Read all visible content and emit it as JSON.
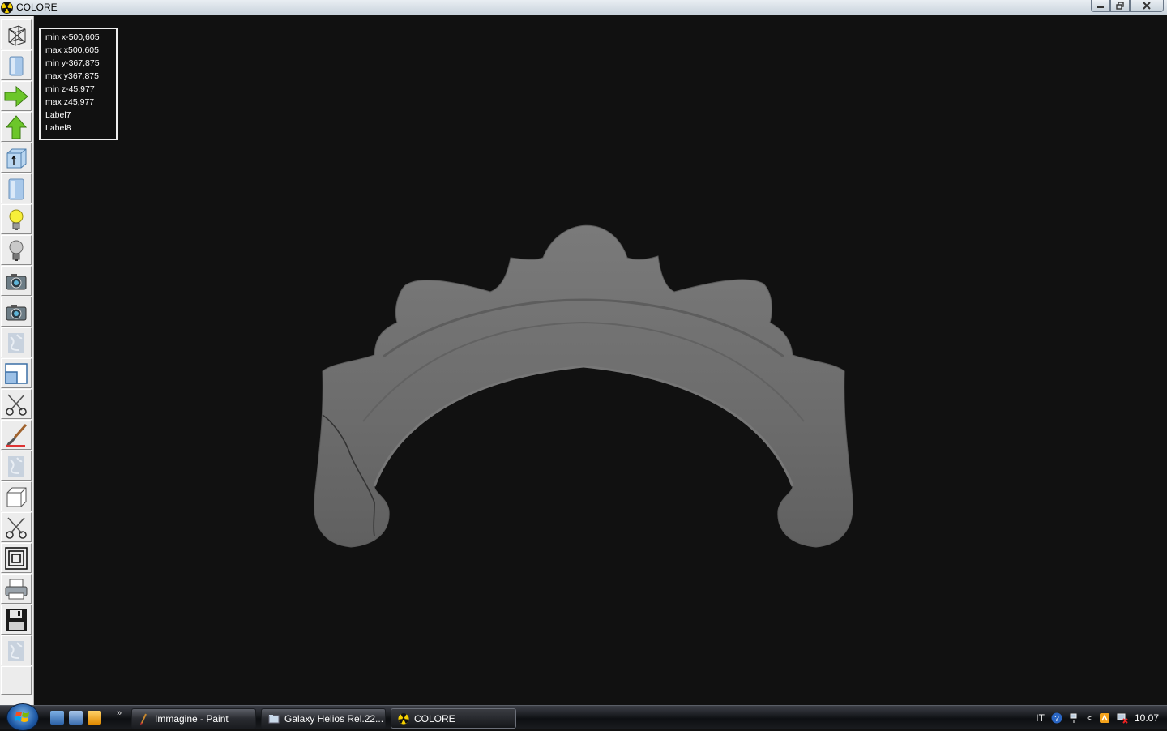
{
  "window": {
    "title": "COLORE",
    "app_icon": "radiation-icon",
    "controls": [
      "minimize-icon",
      "restore-icon",
      "close-icon"
    ]
  },
  "toolbar": {
    "tools": [
      {
        "name": "wireframe-tool",
        "icon": "wireframe-box-icon"
      },
      {
        "name": "solid-view-tool",
        "icon": "blue-cylinder-icon"
      },
      {
        "name": "arrow-right-tool",
        "icon": "green-arrow-right-icon"
      },
      {
        "name": "arrow-up-tool",
        "icon": "green-arrow-up-icon"
      },
      {
        "name": "extrude-tool",
        "icon": "box-arrow-icon"
      },
      {
        "name": "cylinder-tool",
        "icon": "blue-cylinder-icon"
      },
      {
        "name": "light-on-tool",
        "icon": "lightbulb-on-icon"
      },
      {
        "name": "light-off-tool",
        "icon": "lightbulb-off-icon"
      },
      {
        "name": "camera-tool",
        "icon": "camera-icon"
      },
      {
        "name": "camera-2-tool",
        "icon": "camera-icon"
      },
      {
        "name": "texture-tool",
        "icon": "marble-texture-icon"
      },
      {
        "name": "window-split-tool",
        "icon": "window-icon"
      },
      {
        "name": "cut-tool",
        "icon": "scissors-icon"
      },
      {
        "name": "brush-tool",
        "icon": "paintbrush-icon"
      },
      {
        "name": "texture-2-tool",
        "icon": "marble-texture-icon"
      },
      {
        "name": "cube-tool",
        "icon": "cube-icon"
      },
      {
        "name": "cut-2-tool",
        "icon": "scissors-icon"
      },
      {
        "name": "offset-tool",
        "icon": "concentric-squares-icon"
      },
      {
        "name": "print-tool",
        "icon": "printer-icon"
      },
      {
        "name": "save-tool",
        "icon": "floppy-disk-icon"
      },
      {
        "name": "texture-3-tool",
        "icon": "marble-texture-icon"
      }
    ]
  },
  "info": {
    "min_x": "min x-500,605",
    "max_x": "max x500,605",
    "min_y": "min y-367,875",
    "max_y": "max y367,875",
    "min_z": "min z-45,977",
    "max_z": "max z45,977",
    "label7": "Label7",
    "label8": "Label8"
  },
  "taskbar": {
    "start_icon": "windows-logo-icon",
    "quick_launch": [
      "show-desktop-icon",
      "switch-windows-icon",
      "media-player-icon"
    ],
    "overflow": "»",
    "tasks": [
      {
        "label": "Immagine - Paint",
        "icon": "paint-icon"
      },
      {
        "label": "Galaxy Helios  Rel.22...",
        "icon": "folder-icon"
      },
      {
        "label": "COLORE",
        "icon": "radiation-icon"
      }
    ],
    "tray": {
      "language": "IT",
      "icons": [
        "help-icon",
        "network-icon",
        "show-hidden-icon",
        "update-icon",
        "network-alert-icon"
      ],
      "chevron": "<",
      "clock": "10.07"
    }
  },
  "colors": {
    "viewport_bg": "#111111",
    "marble": "#6e6e6e",
    "toolbar_bg": "#f0f0f0"
  }
}
